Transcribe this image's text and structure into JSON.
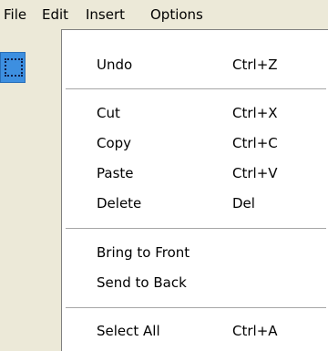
{
  "menubar": {
    "items": [
      {
        "label": "File"
      },
      {
        "label": "Edit"
      },
      {
        "label": "Insert"
      },
      {
        "label": "Options"
      }
    ]
  },
  "toolbar": {
    "active_tool_icon": "selection-rectangle-icon",
    "active_color": "#3d8fe0"
  },
  "edit_menu": {
    "groups": [
      [
        {
          "label": "Undo",
          "shortcut": "Ctrl+Z"
        }
      ],
      [
        {
          "label": "Cut",
          "shortcut": "Ctrl+X"
        },
        {
          "label": "Copy",
          "shortcut": "Ctrl+C"
        },
        {
          "label": "Paste",
          "shortcut": "Ctrl+V"
        },
        {
          "label": "Delete",
          "shortcut": "Del"
        }
      ],
      [
        {
          "label": "Bring to Front",
          "shortcut": ""
        },
        {
          "label": "Send to Back",
          "shortcut": ""
        }
      ],
      [
        {
          "label": "Select All",
          "shortcut": "Ctrl+A"
        }
      ]
    ]
  }
}
